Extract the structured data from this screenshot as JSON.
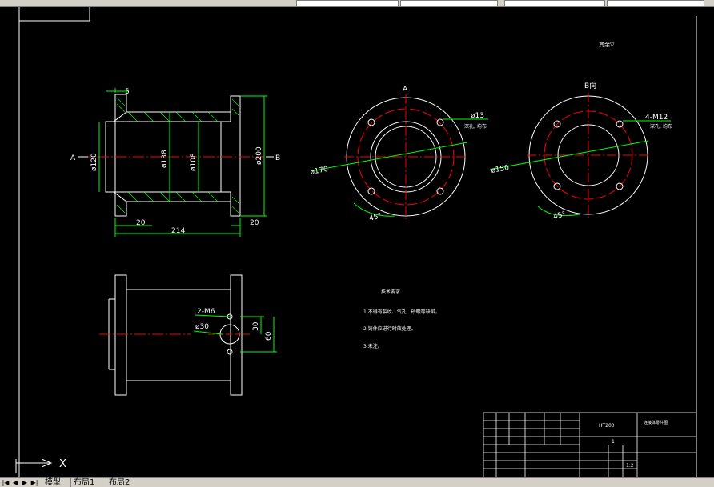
{
  "colors": {
    "green": "#00ff00",
    "red": "#ff0000",
    "white": "#ffffff",
    "bg": "#000000"
  },
  "front_view": {
    "dims": {
      "d5": "5",
      "d120": "ø120",
      "d138": "ø138",
      "d108": "ø108",
      "d200": "ø200",
      "w20": "20",
      "w214": "214",
      "w20b": "20"
    },
    "view_a": "A",
    "view_b": "B"
  },
  "view_a": {
    "title": "A",
    "hole": "ø13",
    "hole_note": "深孔, 均布",
    "pcd": "ø170",
    "angle": "45°"
  },
  "view_b": {
    "title": "B向",
    "thread": "4-M12",
    "thread_note": "深孔, 均布",
    "pcd": "ø150",
    "angle": "45°"
  },
  "side_view": {
    "thread": "2-M6",
    "bore": "ø30",
    "d30": "30",
    "d60": "60"
  },
  "roughness_note": "其余▽",
  "tech_req": {
    "title": "技术要求",
    "items": [
      "1.不得有裂纹、气孔、砂眼等缺陷。",
      "2.铸件应进行时效处理。",
      "3.未注。"
    ]
  },
  "title_block": {
    "material": "HT200",
    "name": "连接体零件图",
    "scale": "1:2",
    "sheet": "1"
  },
  "axis_label": "X",
  "tabs": {
    "model": "模型",
    "layout1": "布局1",
    "layout2": "布局2"
  }
}
